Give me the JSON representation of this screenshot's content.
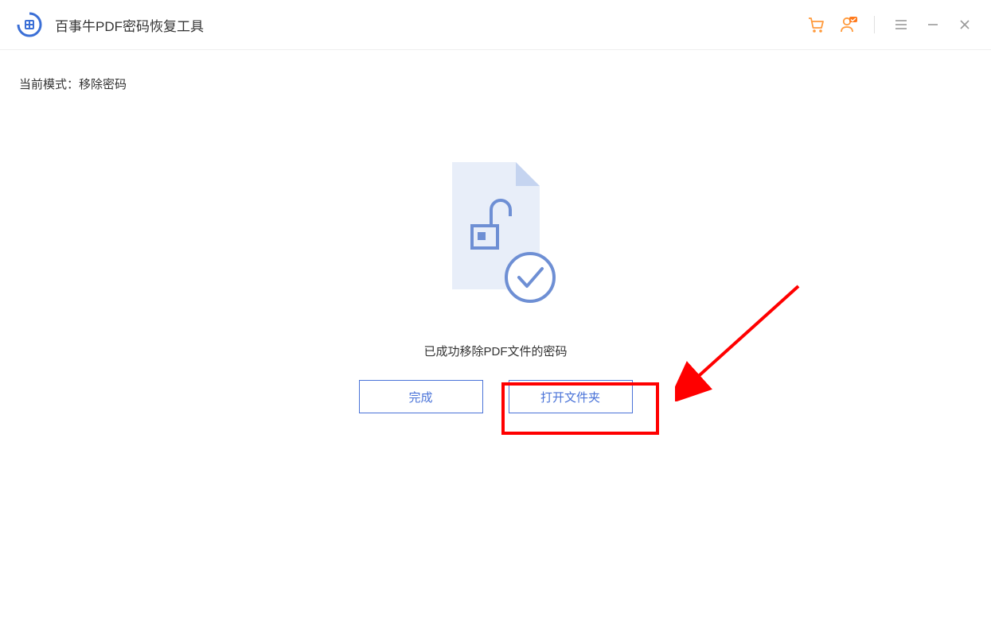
{
  "header": {
    "title": "百事牛PDF密码恢复工具"
  },
  "mode": {
    "label": "当前模式：",
    "value": "移除密码"
  },
  "main": {
    "success_text": "已成功移除PDF文件的密码",
    "complete_btn": "完成",
    "open_folder_btn": "打开文件夹"
  },
  "colors": {
    "primary": "#4a73d8",
    "accent_orange": "#ff9a3c",
    "highlight_red": "#ff0000",
    "doc_fill": "#e8eef9",
    "doc_stroke": "#8fa8df"
  }
}
